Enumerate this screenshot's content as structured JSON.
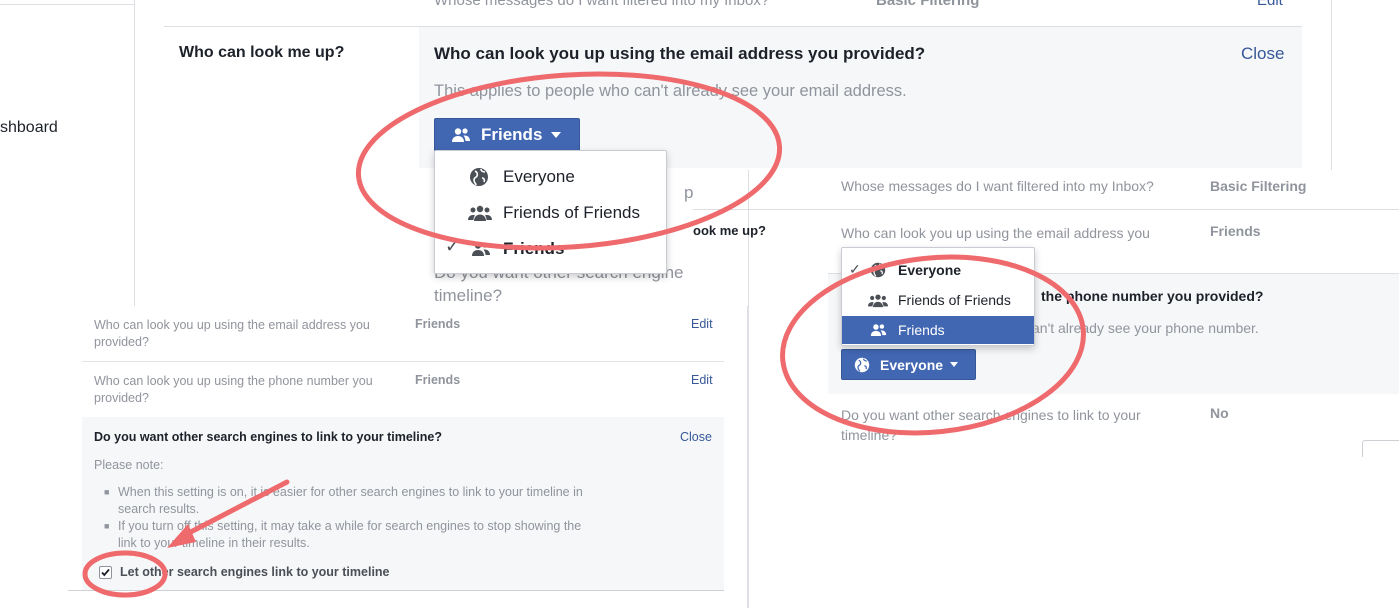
{
  "main_panel": {
    "nav_item_partial": "shboard",
    "row_top_question": "Whose messages do I want filtered into my Inbox?",
    "row_top_value": "Basic Filtering",
    "row_top_action": "Edit",
    "lookup_label": "Who can look me up?",
    "expanded_title": "Who can look you up using the email address you provided?",
    "expanded_close": "Close",
    "expanded_note": "This applies to people who can't already see your email address.",
    "audience_button": "Friends",
    "menu_items": [
      {
        "label": "Everyone",
        "icon": "globe-icon",
        "checked": false
      },
      {
        "label": "Friends of Friends",
        "icon": "friends-of-friends-icon",
        "checked": false
      },
      {
        "label": "Friends",
        "icon": "friends-icon",
        "checked": true
      }
    ],
    "hidden_p": "p",
    "search_partial": "Do you want other search engine",
    "search_timeline": "timeline?"
  },
  "bottom_left": {
    "rows": [
      {
        "question": "Who can look you up using the email address you provided?",
        "value": "Friends",
        "action": "Edit"
      },
      {
        "question": "Who can look you up using the phone number you provided?",
        "value": "Friends",
        "action": "Edit"
      }
    ],
    "search_title": "Do you want other search engines to link to your timeline?",
    "search_close": "Close",
    "please_note": "Please note:",
    "bullets": [
      "When this setting is on, it is easier for other search engines to link to your timeline in search results.",
      "If you turn off this setting, it may take a while for search engines to stop showing the link to your timeline in their results."
    ],
    "checkbox_label": "Let other search engines link to your timeline",
    "checkbox_checked": true
  },
  "bottom_right": {
    "inbox_question": "Whose messages do I want filtered into my Inbox?",
    "inbox_value": "Basic Filtering",
    "lookup_label_partial": "ook me up?",
    "email_question": "Who can look you up using the email address you provided?",
    "email_value": "Friends",
    "phone_title_partial": "the phone number you provided?",
    "phone_note_partial": "an't already see your phone number.",
    "menu_items": [
      {
        "label": "Everyone",
        "icon": "globe-icon",
        "checked": true
      },
      {
        "label": "Friends of Friends",
        "icon": "friends-of-friends-icon",
        "checked": false
      },
      {
        "label": "Friends",
        "icon": "friends-icon",
        "checked": false,
        "highlighted": true
      }
    ],
    "audience_button": "Everyone",
    "search_question": "Do you want other search engines to link to your timeline?",
    "search_value": "No"
  },
  "colors": {
    "facebook_blue": "#4267b2",
    "link_blue": "#365899",
    "annotation_red": "#ef6a6c",
    "gray_text": "#90949c"
  }
}
